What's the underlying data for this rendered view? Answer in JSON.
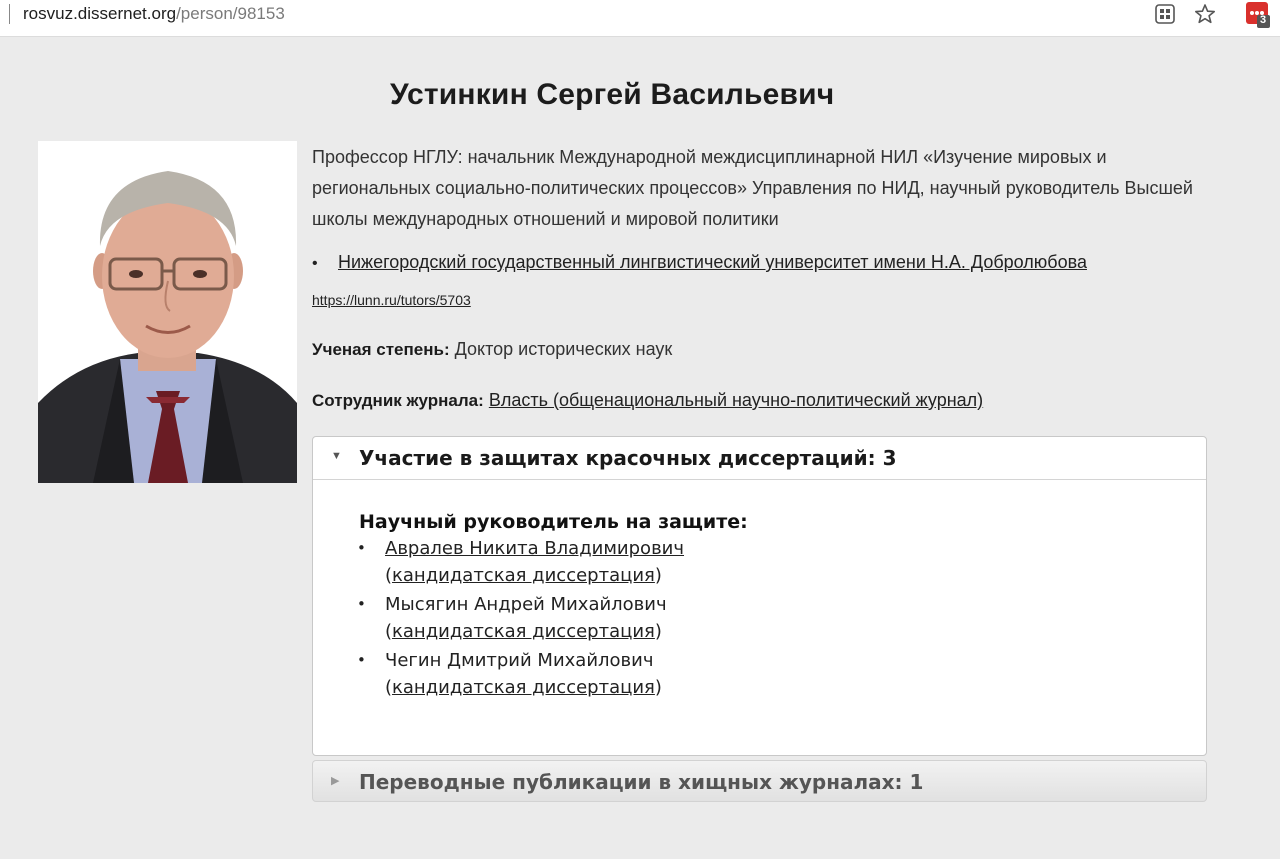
{
  "browser": {
    "url_host": "rosvuz.dissernet.org",
    "url_path": "/person/98153",
    "extension_badge": "3"
  },
  "person": {
    "name": "Устинкин Сергей Васильевич",
    "position": "Профессор НГЛУ: начальник Международной междисциплинарной НИЛ «Изучение мировых и региональных социально-политических процессов» Управления по НИД, научный руководитель Высшей школы международных отношений и мировой политики",
    "university": "Нижегородский государственный лингвистический университет имени Н.А. Добролюбова",
    "profile_url": "https://lunn.ru/tutors/5703",
    "degree_label": "Ученая степень:",
    "degree_value": "Доктор исторических наук",
    "journal_label": "Сотрудник журнала:",
    "journal_value": "Власть (общенациональный научно-политический журнал)"
  },
  "sections": {
    "defenses": {
      "title": "Участие в защитах красочных диссертаций: 3",
      "role_heading": "Научный руководитель на защите:",
      "items": [
        {
          "name": "Авралев Никита Владимирович",
          "type": "кандидатская диссертация"
        },
        {
          "name": "Мысягин Андрей Михайлович",
          "type": "кандидатская диссертация"
        },
        {
          "name": "Чегин Дмитрий Михайлович",
          "type": "кандидатская диссертация"
        }
      ]
    },
    "predatory": {
      "title": "Переводные публикации в хищных журналах: 1"
    }
  },
  "colors": {
    "background": "#ebebeb",
    "extension_red": "#d9302c"
  }
}
